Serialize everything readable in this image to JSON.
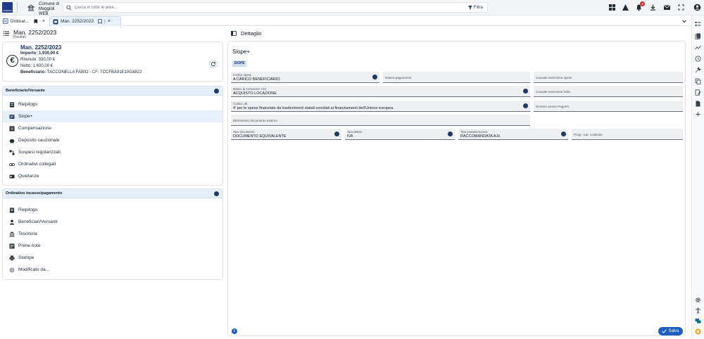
{
  "topbar": {
    "logo_text": "Comune",
    "org_name": "Comune di Maggioli WEB",
    "search_placeholder": "Cerca in tutte le aree...",
    "filter_label": "Filtra",
    "notification_count": "4",
    "icons": [
      "dashboard-icon",
      "alert-icon",
      "bell-icon",
      "download-icon",
      "mail-icon",
      "fullscreen-icon",
      "user-icon"
    ]
  },
  "tabs": [
    {
      "label": "Ordinat...",
      "icon": "list-icon",
      "active": false
    },
    {
      "label": "Man. 2252/2023",
      "icon": "document-icon",
      "active": true
    }
  ],
  "left": {
    "title": "Man. 2252/2023",
    "subtitle": "Risultati",
    "card": {
      "title": "Man. 2252/2023",
      "importo": "Importo: 1.930,00 €",
      "ritenute": "Ritenute: 330,00 €",
      "netto": "Netto: 1.600,00 €",
      "beneficiario_label": "Beneficiario:",
      "beneficiario_value": "TACCONELLA FABIO - CF: TCCFBA91E10G482J"
    },
    "section1": {
      "title": "Beneficiario/Versante",
      "items": [
        {
          "label": "Riepilogo",
          "icon": "summary-icon",
          "active": false
        },
        {
          "label": "Siope+",
          "icon": "siope-icon",
          "active": true
        },
        {
          "label": "Compensazione",
          "icon": "compensation-icon",
          "active": false
        },
        {
          "label": "Deposito cauzionale",
          "icon": "piggy-bank-icon",
          "active": false
        },
        {
          "label": "Sospesi regolarizzati",
          "icon": "link-nodes-icon",
          "active": false
        },
        {
          "label": "Ordinativi collegati",
          "icon": "chain-link-icon",
          "active": false
        },
        {
          "label": "Quietanze",
          "icon": "receipt-icon",
          "active": false
        }
      ]
    },
    "section2": {
      "title": "Ordinativo incasso/pagamento",
      "items": [
        {
          "label": "Riepilogo",
          "icon": "summary-icon"
        },
        {
          "label": "Beneficiari/Versanti",
          "icon": "person-icon"
        },
        {
          "label": "Tesoreria",
          "icon": "bank-icon"
        },
        {
          "label": "Prime note",
          "icon": "notes-icon"
        },
        {
          "label": "Stampe",
          "icon": "printer-icon"
        },
        {
          "label": "Modificato da...",
          "icon": "clock-icon"
        }
      ]
    }
  },
  "detail": {
    "header": "Dettaglio",
    "section_title": "Siope+",
    "logo_text": "SIOPE",
    "fields": {
      "codice_spese": {
        "label": "Codice spese",
        "value": "A CARICO BENEFICIARIO"
      },
      "natura_pagamento": {
        "placeholder": "Natura pagamento"
      },
      "causale_esenzione_spese": {
        "placeholder": "Causale esenzione spese"
      },
      "motivo_esclusione_cig": {
        "label": "Motivo di esclusione CIG",
        "value": "ACQUISTO LOCAZIONE"
      },
      "causale_esenzione_bollo": {
        "placeholder": "Causale esenzione bollo"
      },
      "codice_ue": {
        "label": "Codice UE",
        "value": "4' per le spese finanziate da trasferimenti statali correlati ai finanziamenti dell'Unione europea."
      },
      "numero_avviso_pagopa": {
        "placeholder": "Numero avviso PagoPA"
      },
      "riferimento_documento_esterno": {
        "placeholder": "Riferimento documento esterno"
      },
      "tipo_documento": {
        "label": "Tipo documento",
        "value": "DOCUMENTO EQUIVALENTE"
      },
      "tipo_debito": {
        "label": "Tipo debito",
        "value": "IVA"
      },
      "tipo_postalizzazione": {
        "label": "Tipo postalizzazione",
        "value": "RACCOMANDATA A.R."
      },
      "progr_sub_sostituito": {
        "placeholder": "Progr. sub. sostituito"
      }
    },
    "save_label": "Salva"
  },
  "colors": {
    "primary": "#1f5fbf",
    "navy": "#1f3a66",
    "section_header": "#e6eef8",
    "field_bg": "#eeeff1",
    "badge": "#dc2626"
  }
}
